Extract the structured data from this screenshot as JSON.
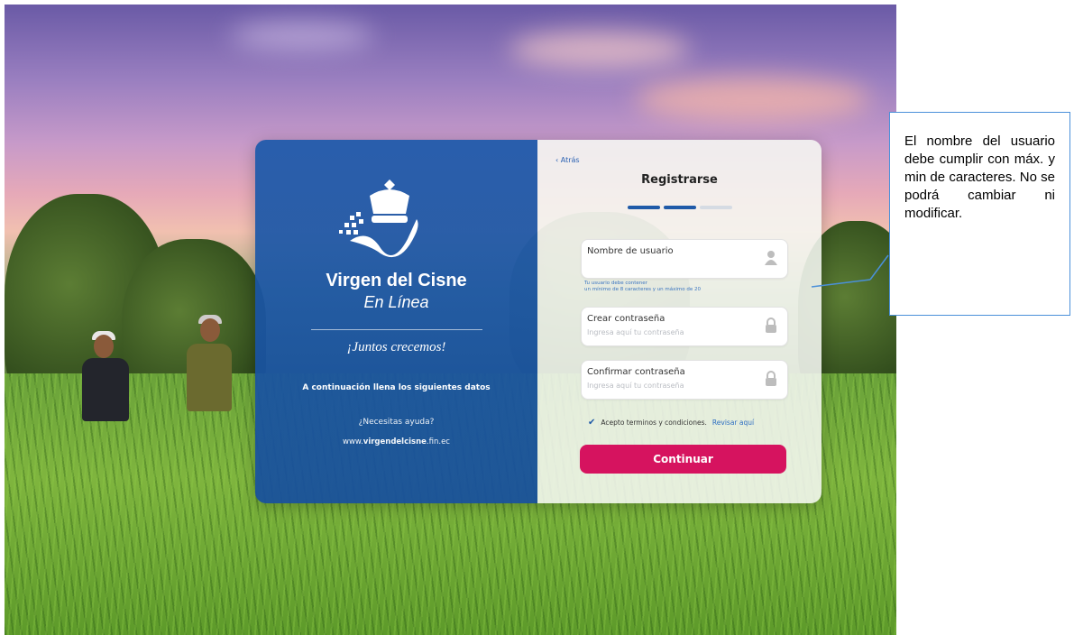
{
  "brand": {
    "name": "Virgen del Cisne",
    "subtitle": "En Línea",
    "slogan": "¡Juntos crecemos!",
    "instructions": "A continuación llena los siguientes datos",
    "help_question": "¿Necesitas ayuda?",
    "website_prefix": "www.",
    "website_bold": "virgendelcisne",
    "website_suffix": ".fin.ec"
  },
  "form": {
    "back_label": "Atrás",
    "title": "Registrarse",
    "steps": [
      {
        "active": true
      },
      {
        "active": true
      },
      {
        "active": false
      }
    ],
    "username": {
      "label": "Nombre de usuario",
      "value": "",
      "hint_line1": "Tu usuario debe contener",
      "hint_line2": "un mínimo de 8 caracteres y un máximo de 20",
      "icon": "user-icon"
    },
    "password": {
      "label": "Crear contraseña",
      "placeholder": "Ingresa aquí tu contraseña",
      "icon": "lock-icon"
    },
    "confirm_password": {
      "label": "Confirmar contraseña",
      "placeholder": "Ingresa aquí tu contraseña",
      "icon": "lock-icon"
    },
    "terms_text": "Acepto terminos y condiciones.",
    "terms_link": "Revisar aquí",
    "terms_checked": true,
    "submit_label": "Continuar"
  },
  "annotation": {
    "text": "El nombre del usuario debe cumplir con máx. y min de caracteres. No se podrá cambiar ni modificar."
  },
  "colors": {
    "brand_blue": "#1f5aa8",
    "button_pink": "#d6135f",
    "annotation_border": "#4a90d9"
  }
}
